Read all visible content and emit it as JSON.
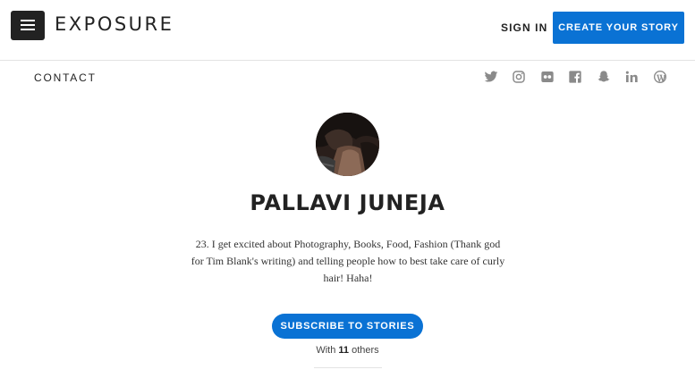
{
  "header": {
    "menu_icon": "hamburger-icon",
    "logo_text": "EXPOSURE",
    "signin_label": "SIGN IN",
    "create_label": "CREATE YOUR STORY"
  },
  "subnav": {
    "contact_label": "CONTACT",
    "social_icons": [
      "twitter-icon",
      "instagram-icon",
      "flickr-icon",
      "facebook-icon",
      "snapchat-icon",
      "linkedin-icon",
      "wordpress-icon"
    ]
  },
  "profile": {
    "name": "PALLAVI JUNEJA",
    "bio": "23. I get excited about Photography, Books, Food, Fashion (Thank god for Tim Blank's writing) and telling people how to best take care of curly hair! Haha!",
    "subscribe_label": "SUBSCRIBE TO STORIES",
    "with_prefix": "With",
    "subscriber_count": "11",
    "with_suffix": "others"
  },
  "colors": {
    "accent": "#0a72d4",
    "text": "#222222",
    "icon": "#888888"
  }
}
